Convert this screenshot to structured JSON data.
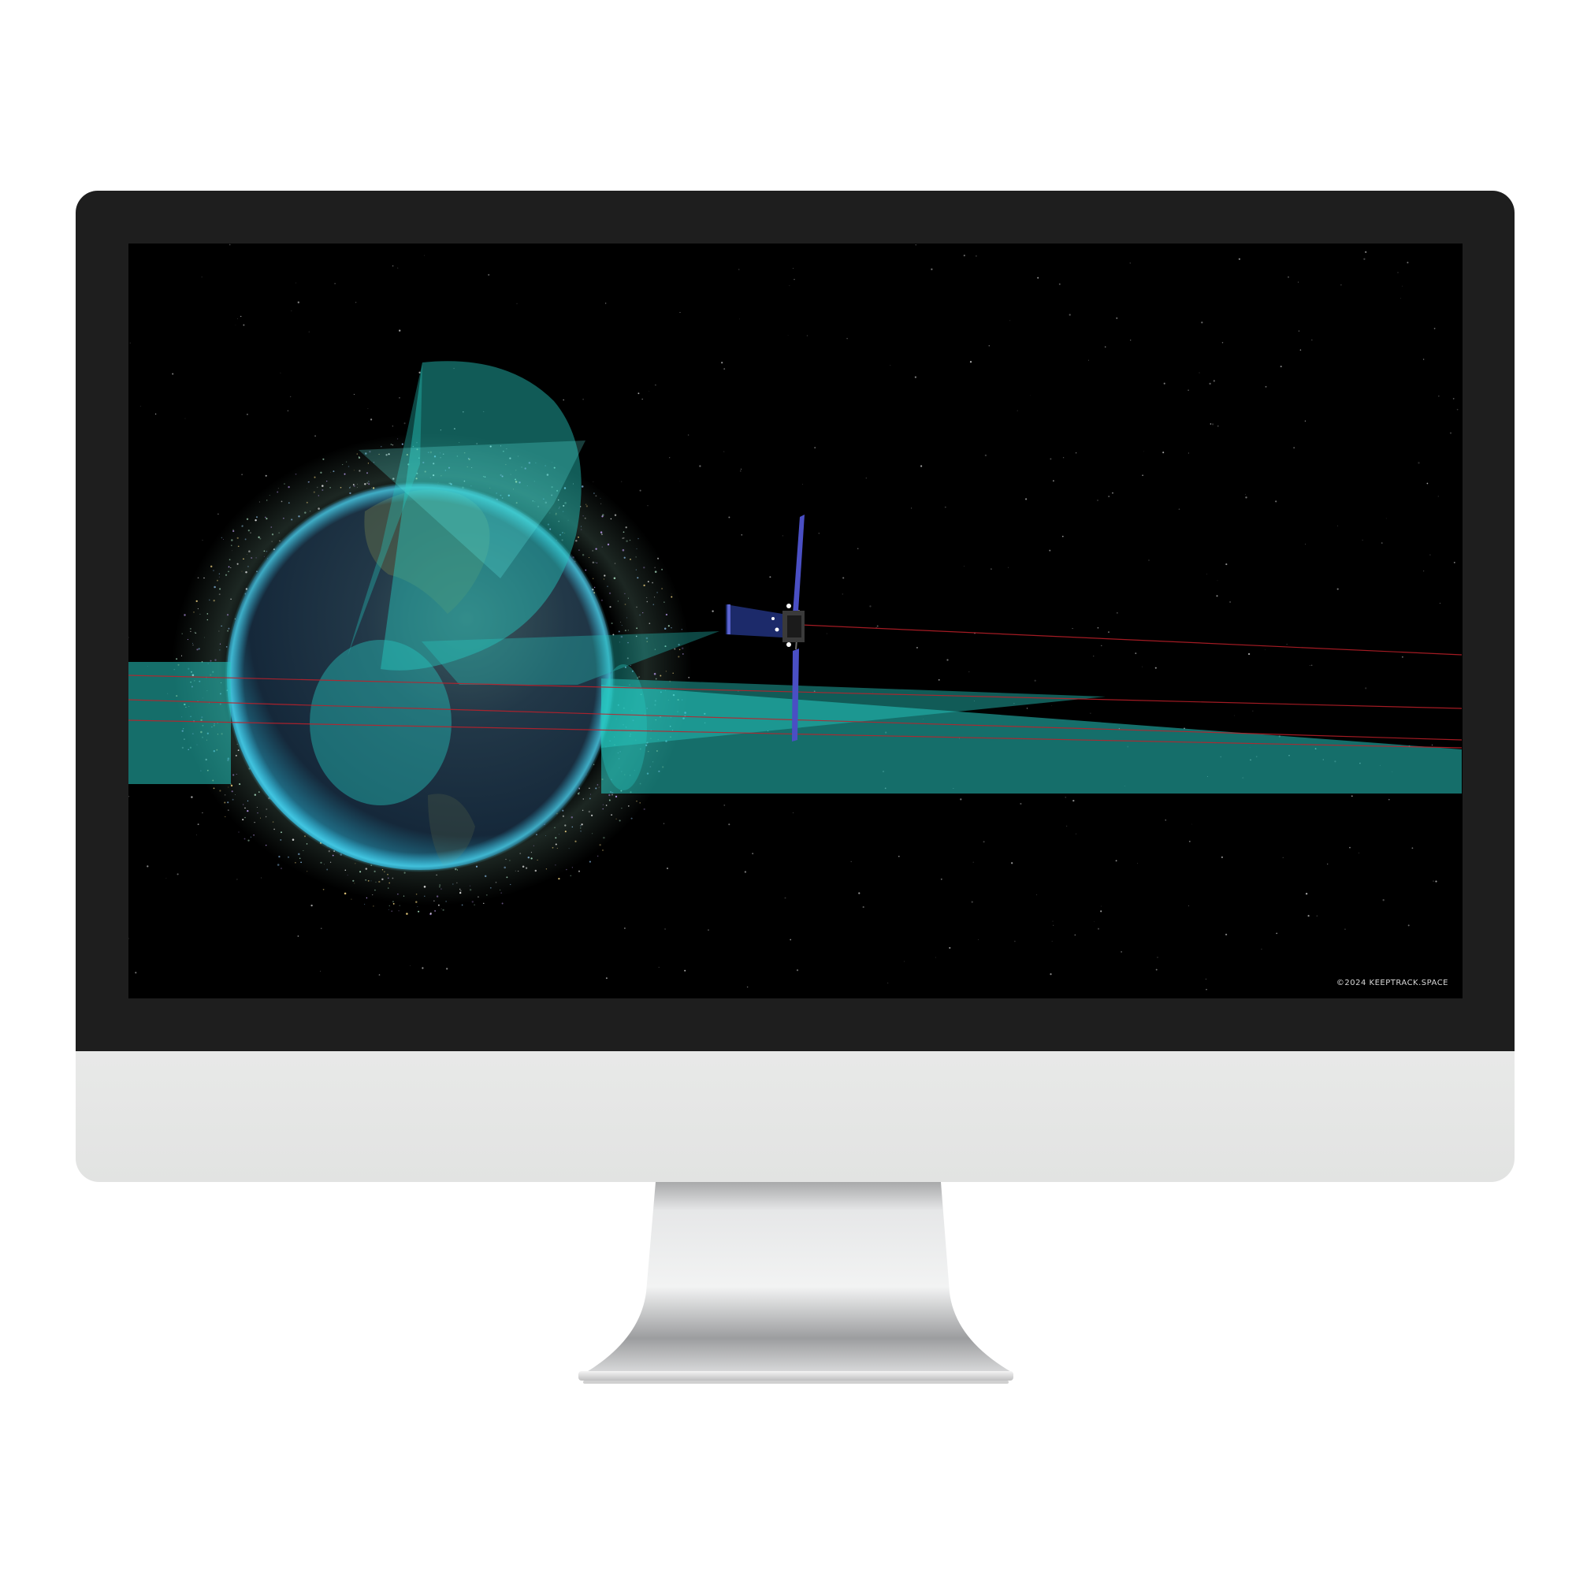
{
  "screen": {
    "watermark": "©2024 KEEPTRACK.SPACE"
  },
  "colors": {
    "sensor_cone": "#26c9c1",
    "orbit_line": "#c0202a",
    "solar_panel": "#4a4fc4",
    "bezel": "#1e1e1e",
    "chin": "#e5e6e5"
  },
  "scene": {
    "earth": "earth-globe",
    "satellite": "satellite-model",
    "fields_of_view": [
      "sensor-fov-cone",
      "sensor-fov-beam-left",
      "sensor-fov-beam-right"
    ],
    "orbits": [
      "orbit-line",
      "orbit-line",
      "orbit-line",
      "orbit-line"
    ]
  }
}
